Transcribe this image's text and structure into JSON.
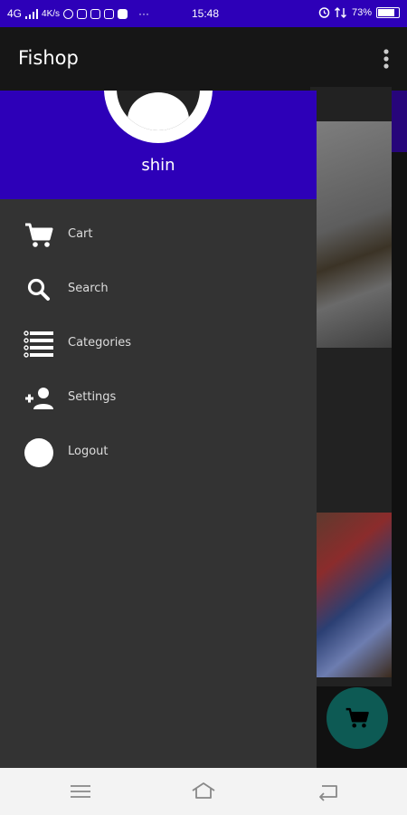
{
  "status_bar": {
    "network": "4G",
    "speed": "4K/s",
    "time": "15:48",
    "battery": "73%",
    "more": "···"
  },
  "app_bar": {
    "title": "Fishop",
    "overflow_icon": "more-vert-icon"
  },
  "drawer": {
    "user_name": "shin",
    "header_color": "#2d00b8",
    "items": [
      {
        "label": "Cart",
        "icon": "cart-icon"
      },
      {
        "label": "Search",
        "icon": "search-icon"
      },
      {
        "label": "Categories",
        "icon": "list-icon"
      },
      {
        "label": "Settings",
        "icon": "add-person-icon"
      },
      {
        "label": "Logout",
        "icon": "circle-icon"
      }
    ]
  },
  "fab": {
    "icon": "cart-icon",
    "color": "#0d5a54"
  },
  "nav_bar": {
    "icons": [
      "menu-icon",
      "home-icon",
      "back-icon"
    ]
  }
}
